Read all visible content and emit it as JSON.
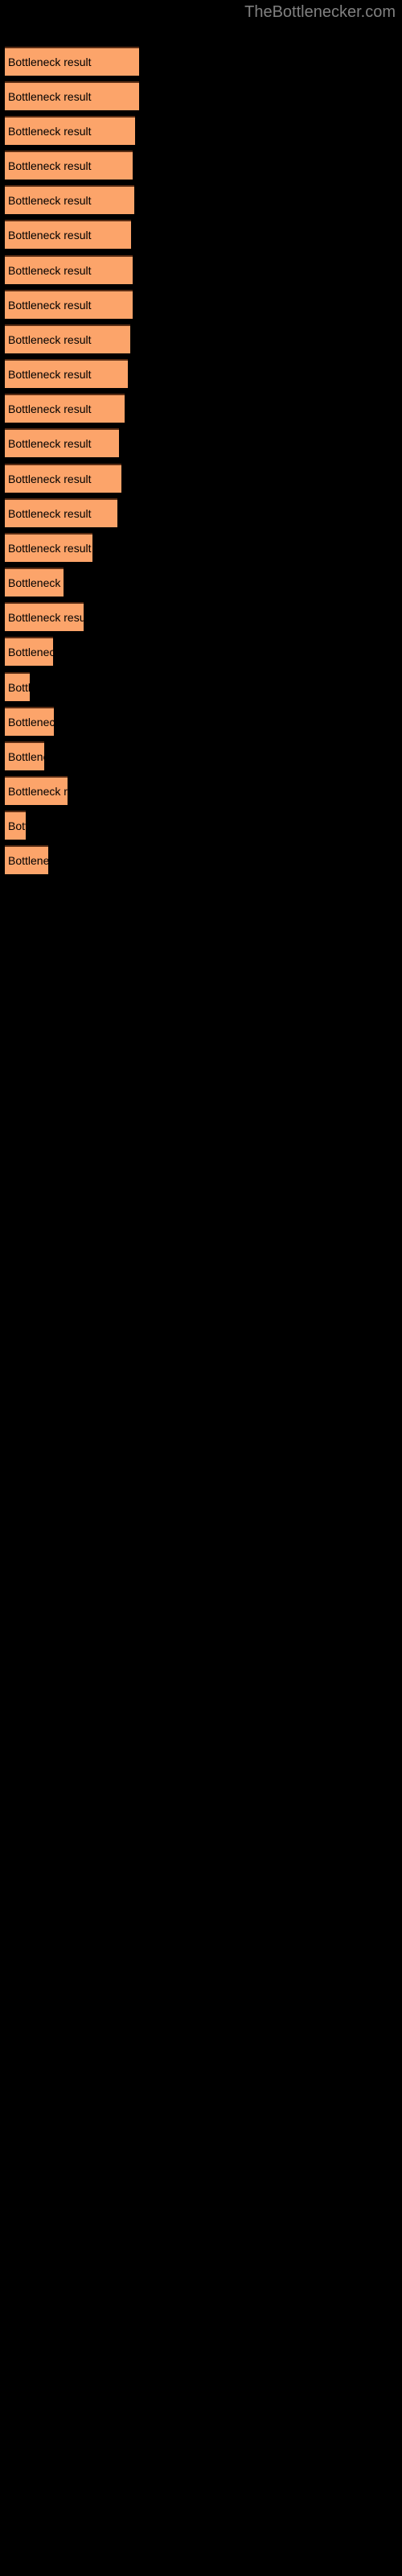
{
  "site": {
    "title": "TheBottlenecker.com",
    "title_color": "#808080"
  },
  "theme": {
    "background": "#000000",
    "bar_fill": "#FCA46A",
    "bar_border_top": "#5a2d14",
    "label_color": "#000000"
  },
  "chart_data": {
    "type": "bar",
    "orientation": "horizontal",
    "title": "",
    "subtitle": "",
    "xlabel": "",
    "ylabel": "",
    "grid": false,
    "legend": null,
    "axis_visible": false,
    "tick_labels": [],
    "bar_label_text": "Bottleneck result",
    "categories": [
      "Bottleneck result",
      "Bottleneck result",
      "Bottleneck result",
      "Bottleneck result",
      "Bottleneck result",
      "Bottleneck result",
      "Bottleneck result",
      "Bottleneck result",
      "Bottleneck result",
      "Bottleneck result",
      "Bottleneck result",
      "Bottleneck result",
      "Bottleneck result",
      "Bottleneck result",
      "Bottleneck result",
      "Bottleneck result",
      "Bottleneck result",
      "Bottleneck result",
      "Bottleneck result",
      "Bottleneck result",
      "Bottleneck result",
      "Bottleneck result",
      "Bottleneck result",
      "Bottleneck result"
    ],
    "values": [
      167,
      167,
      162,
      159,
      161,
      157,
      159,
      159,
      156,
      153,
      149,
      142,
      145,
      140,
      109,
      73,
      98,
      60,
      31,
      61,
      49,
      78,
      26,
      54
    ],
    "xlim": [
      0,
      500
    ],
    "bars": [
      {
        "label": "Bottleneck result",
        "value": 167,
        "top": 58
      },
      {
        "label": "Bottleneck result",
        "value": 167,
        "top": 101
      },
      {
        "label": "Bottleneck result",
        "value": 162,
        "top": 144
      },
      {
        "label": "Bottleneck result",
        "value": 159,
        "top": 187
      },
      {
        "label": "Bottleneck result",
        "value": 161,
        "top": 230
      },
      {
        "label": "Bottleneck result",
        "value": 157,
        "top": 273
      },
      {
        "label": "Bottleneck result",
        "value": 159,
        "top": 317
      },
      {
        "label": "Bottleneck result",
        "value": 159,
        "top": 360
      },
      {
        "label": "Bottleneck result",
        "value": 156,
        "top": 403
      },
      {
        "label": "Bottleneck result",
        "value": 153,
        "top": 446
      },
      {
        "label": "Bottleneck result",
        "value": 149,
        "top": 489
      },
      {
        "label": "Bottleneck result",
        "value": 142,
        "top": 532
      },
      {
        "label": "Bottleneck result",
        "value": 145,
        "top": 576
      },
      {
        "label": "Bottleneck result",
        "value": 140,
        "top": 619
      },
      {
        "label": "Bottleneck result",
        "value": 109,
        "top": 662
      },
      {
        "label": "Bottleneck result",
        "value": 73,
        "top": 705
      },
      {
        "label": "Bottleneck result",
        "value": 98,
        "top": 748
      },
      {
        "label": "Bottleneck result",
        "value": 60,
        "top": 791
      },
      {
        "label": "Bottleneck result",
        "value": 31,
        "top": 835
      },
      {
        "label": "Bottleneck result",
        "value": 61,
        "top": 878
      },
      {
        "label": "Bottleneck result",
        "value": 49,
        "top": 921
      },
      {
        "label": "Bottleneck result",
        "value": 78,
        "top": 964
      },
      {
        "label": "Bottleneck result",
        "value": 26,
        "top": 1007
      },
      {
        "label": "Bottleneck result",
        "value": 54,
        "top": 1050
      }
    ]
  }
}
